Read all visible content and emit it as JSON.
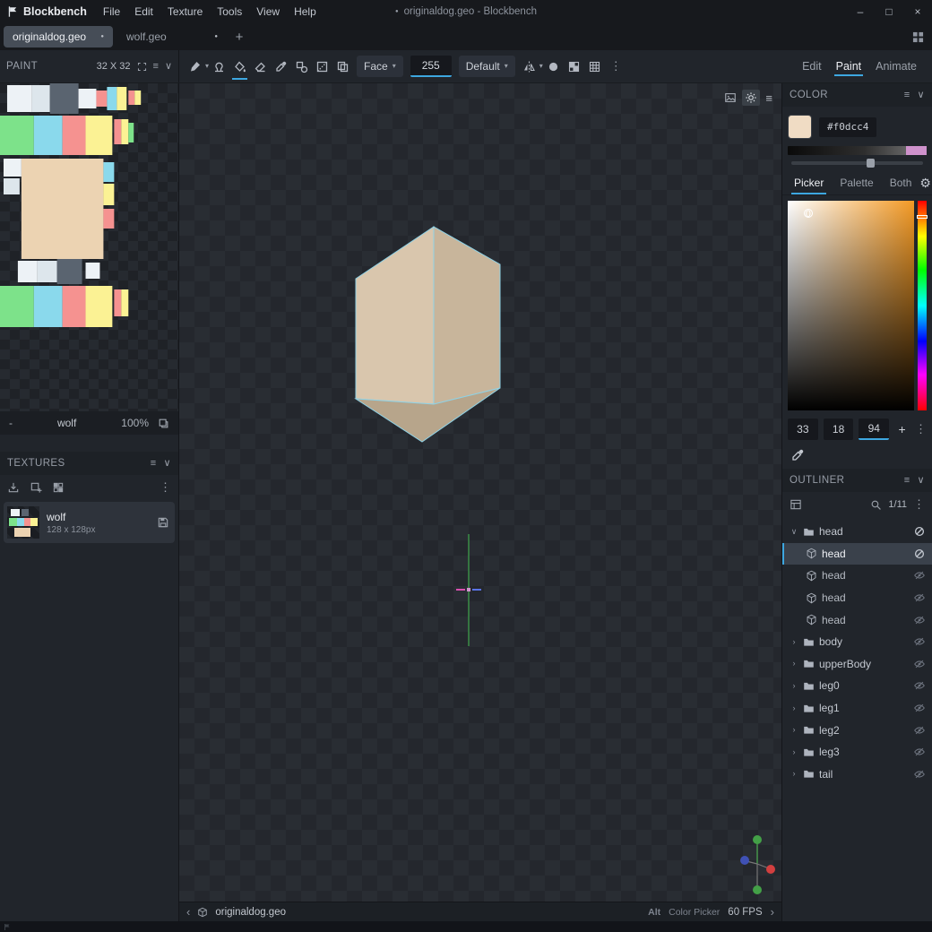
{
  "icons": {
    "menu": "≡",
    "collapse": "∨",
    "overflow": "⋮",
    "caret": "▾",
    "chevron_expanded": "∨",
    "chevron_collapsed": "›",
    "minimize": "–",
    "maximize": "□",
    "close": "×",
    "add_tab": "+",
    "unsaved_dot": "●",
    "back": "‹",
    "forward": "›",
    "gear": "⚙",
    "add": "+"
  },
  "colors": {
    "accent": "#3da7e0",
    "selected_color": "#f0dcc4"
  },
  "titlebar": {
    "app_name": "Blockbench",
    "menus": [
      "File",
      "Edit",
      "Texture",
      "Tools",
      "View",
      "Help"
    ],
    "window_title": "originaldog.geo - Blockbench"
  },
  "tabbar": {
    "tabs": [
      {
        "label": "originaldog.geo",
        "active": true
      },
      {
        "label": "wolf.geo",
        "active": false
      }
    ]
  },
  "paint_panel": {
    "title": "PAINT",
    "texture_size": "32 X 32",
    "footer": {
      "minus": "-",
      "texture_name": "wolf",
      "zoom": "100%"
    }
  },
  "toolbar": {
    "face_select": "Face",
    "opacity": "255",
    "blend_mode": "Default"
  },
  "mode_tabs": {
    "items": [
      "Edit",
      "Paint",
      "Animate"
    ],
    "active": "Paint"
  },
  "color_panel": {
    "title": "COLOR",
    "hex": "#f0dcc4",
    "swatch_color": "#f0dcc4",
    "tabs": [
      "Picker",
      "Palette",
      "Both"
    ],
    "active_tab": "Picker",
    "picker_cursor_label": "0",
    "values": [
      "33",
      "18",
      "94"
    ]
  },
  "textures_panel": {
    "title": "TEXTURES",
    "items": [
      {
        "name": "wolf",
        "resolution": "128 x 128px"
      }
    ]
  },
  "outliner": {
    "title": "OUTLINER",
    "counter": "1/11",
    "items": [
      {
        "label": "head",
        "type": "group",
        "expanded": true
      },
      {
        "label": "head",
        "type": "cube",
        "selected": true
      },
      {
        "label": "head",
        "type": "cube"
      },
      {
        "label": "head",
        "type": "cube"
      },
      {
        "label": "head",
        "type": "cube"
      },
      {
        "label": "body",
        "type": "group"
      },
      {
        "label": "upperBody",
        "type": "group"
      },
      {
        "label": "leg0",
        "type": "group"
      },
      {
        "label": "leg1",
        "type": "group"
      },
      {
        "label": "leg2",
        "type": "group"
      },
      {
        "label": "leg3",
        "type": "group"
      },
      {
        "label": "tail",
        "type": "group"
      }
    ]
  },
  "statusbar": {
    "project_name": "originaldog.geo",
    "shortcut_key": "Alt",
    "shortcut_action": "Color Picker",
    "fps": "60 FPS"
  },
  "texture_palette": [
    "#edf2f6",
    "#dde6ec",
    "#5a6470",
    "#7de28a",
    "#8ad9ec",
    "#f59290",
    "#fbf294",
    "#ecd3b2"
  ]
}
